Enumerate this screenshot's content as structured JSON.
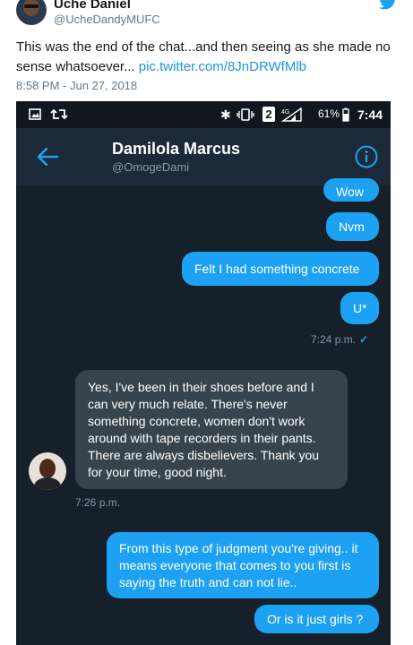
{
  "tweet": {
    "author_name": "Uche Daniel",
    "author_handle": "@UcheDandyMUFC",
    "text": "This was the end of the chat...and then seeing as she made no sense whatsoever...",
    "link": "pic.twitter.com/8JnDRWfMlb",
    "timestamp": "8:58 PM - Jun 27, 2018"
  },
  "status_bar": {
    "sim_badge": "2",
    "battery": "61%",
    "time": "7:44"
  },
  "conversation": {
    "contact_name": "Damilola Marcus",
    "contact_handle": "@OmogeDami"
  },
  "messages": [
    {
      "text": "Wow",
      "direction": "out"
    },
    {
      "text": "Nvm",
      "direction": "out"
    },
    {
      "text": "Felt I had something concrete",
      "direction": "out"
    },
    {
      "text": "U*",
      "direction": "out"
    },
    {
      "text": "Yes, I've been in their shoes before and I can very much relate. There's never something concrete, women don't work around with tape recorders in their pants. There are always disbelievers. Thank you for your time, good night.",
      "direction": "in"
    },
    {
      "text": "From this type of judgment you're giving.. it means everyone that comes to you first is saying the truth and can not lie..",
      "direction": "out"
    },
    {
      "text": "Or is it just girls ?",
      "direction": "out"
    }
  ],
  "timestamps": {
    "out_read": "7:24 p.m.",
    "in_time": "7:26 p.m."
  },
  "colors": {
    "twitter_blue": "#1da1f2",
    "dm_background": "#15202b",
    "incoming_bubble": "#38444d"
  }
}
